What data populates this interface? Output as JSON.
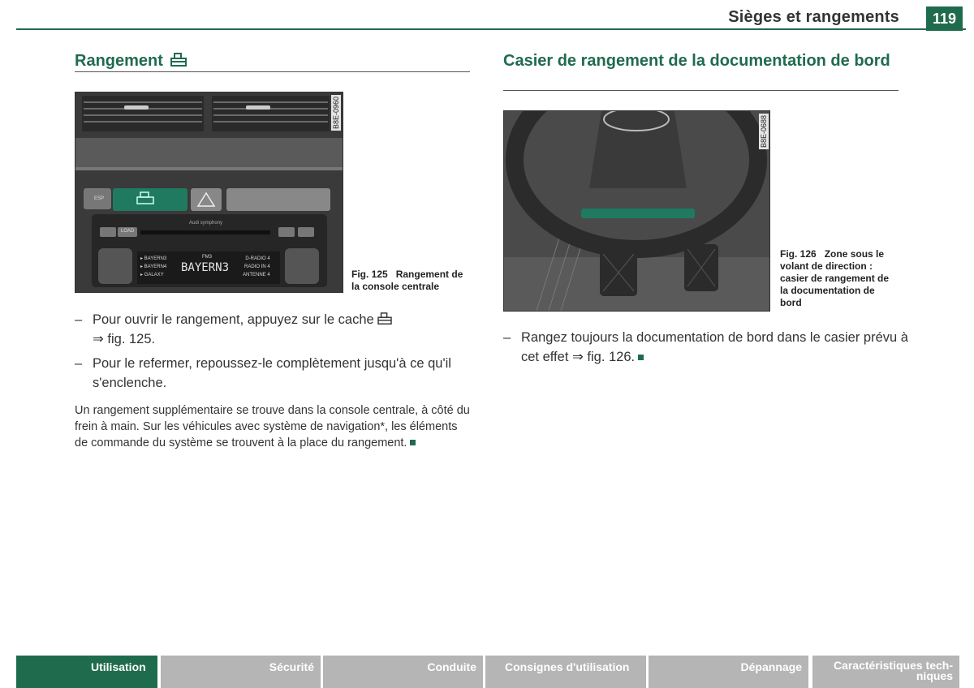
{
  "header": {
    "title": "Sièges et rangements",
    "page_number": "119"
  },
  "left": {
    "title": "Rangement",
    "figure_code": "B8E-0960",
    "radio": {
      "brand": "Audi symphony",
      "stations_left": [
        "▸ BAYERN3",
        "▸ BAYERN4",
        "▸ GALAXY"
      ],
      "band": "FM3",
      "main_station": "BAYERN3",
      "stations_right": [
        "D-RADIO 4",
        "RADIO IN 4",
        "ANTENNE 4"
      ],
      "esp_label": "ESP",
      "load_label": "LOAD"
    },
    "caption_num": "Fig. 125",
    "caption_text": "Rangement de la console centrale",
    "bullets": [
      {
        "text": "Pour ouvrir le rangement, appuyez sur le cache",
        "ref": "⇒ fig. 125."
      },
      {
        "text": "Pour le refermer, repoussez-le complètement jusqu'à ce qu'il s'enclenche.",
        "ref": ""
      }
    ],
    "paragraph": "Un rangement supplémentaire se trouve dans la console centrale, à côté du frein à main. Sur les véhicules avec système de navigation*, les éléments de commande du système se trouvent à la place du rangement."
  },
  "right": {
    "title": "Casier de rangement de la documentation de bord",
    "figure_code": "B8E-0688",
    "caption_num": "Fig. 126",
    "caption_text": "Zone sous le volant de direction : casier de rangement de la documentation de bord",
    "bullet": "Rangez toujours la documentation de bord dans le casier prévu à cet effet ⇒ fig. 126."
  },
  "footer": {
    "tabs": [
      "Utilisation",
      "Sécurité",
      "Conduite",
      "Consignes d'utilisation",
      "Dépannage",
      "Caractéristiques tech-niques"
    ],
    "tab_last_line1": "Caractéristiques tech-",
    "tab_last_line2": "niques"
  },
  "colors": {
    "accent": "#1f6b4e",
    "tab_inactive": "#b5b5b5"
  },
  "icons": [
    "storage-compartment-icon",
    "hazard-triangle-icon",
    "end-of-section-mark"
  ]
}
